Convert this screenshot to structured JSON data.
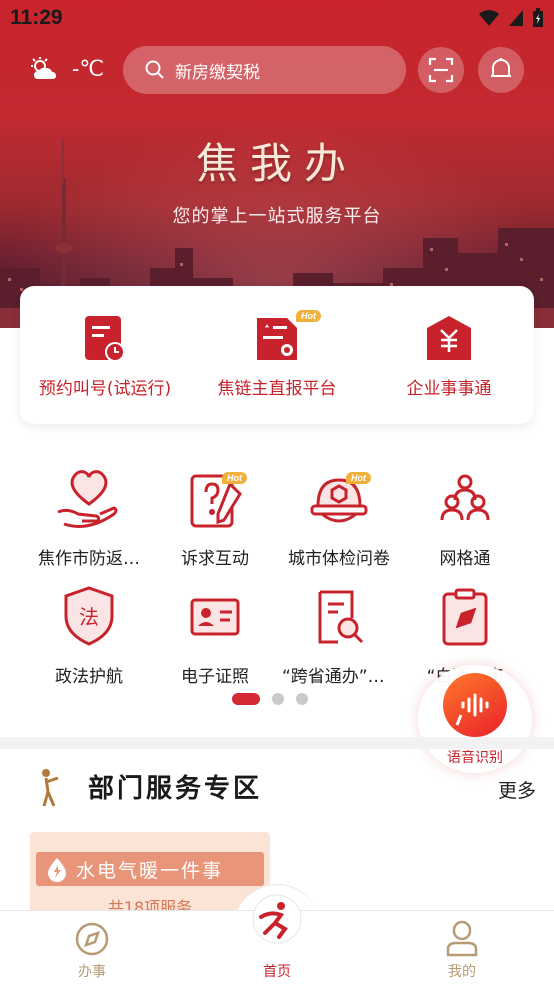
{
  "status_bar": {
    "time": "11:29"
  },
  "header": {
    "weather_temp": "-℃",
    "search_placeholder": "新房缴契税",
    "brand_title": "焦我办",
    "brand_subtitle": "您的掌上一站式服务平台"
  },
  "quick_services": [
    {
      "label": "预约叫号(试运行)",
      "icon": "calendar-clock-icon",
      "hot": false
    },
    {
      "label": "焦链主直报平台",
      "icon": "report-doc-icon",
      "hot": true
    },
    {
      "label": "企业事事通",
      "icon": "enterprise-house-icon",
      "hot": false
    }
  ],
  "grid_services": [
    {
      "label": "焦作市防返…",
      "icon": "heart-hand-icon",
      "hot": false
    },
    {
      "label": "诉求互动",
      "icon": "question-pen-icon",
      "hot": true
    },
    {
      "label": "城市体检问卷",
      "icon": "helmet-icon",
      "hot": true
    },
    {
      "label": "网格通",
      "icon": "people-network-icon",
      "hot": false
    },
    {
      "label": "政法护航",
      "icon": "law-shield-icon",
      "hot": false
    },
    {
      "label": "电子证照",
      "icon": "id-card-icon",
      "hot": false
    },
    {
      "label": "“跨省通办”清…",
      "icon": "doc-search-icon",
      "hot": false
    },
    {
      "label": "“白通…南",
      "icon": "clipboard-compass-icon",
      "hot": false
    }
  ],
  "hot_badge": "Hot",
  "pagination": {
    "pages": 3,
    "active": 1
  },
  "voice": {
    "label": "语音识别"
  },
  "dept_section": {
    "title": "部门服务专区",
    "more": "更多"
  },
  "service_card": {
    "title": "水电气暖一件事",
    "count": "共18项服务"
  },
  "tabbar": {
    "items": [
      {
        "label": "办事"
      },
      {
        "label": "首页"
      },
      {
        "label": "我的"
      }
    ],
    "active": 1
  },
  "colors": {
    "brand_red": "#c8232c",
    "hot_orange": "#f0b13c",
    "tab_inactive": "#b69b74"
  }
}
